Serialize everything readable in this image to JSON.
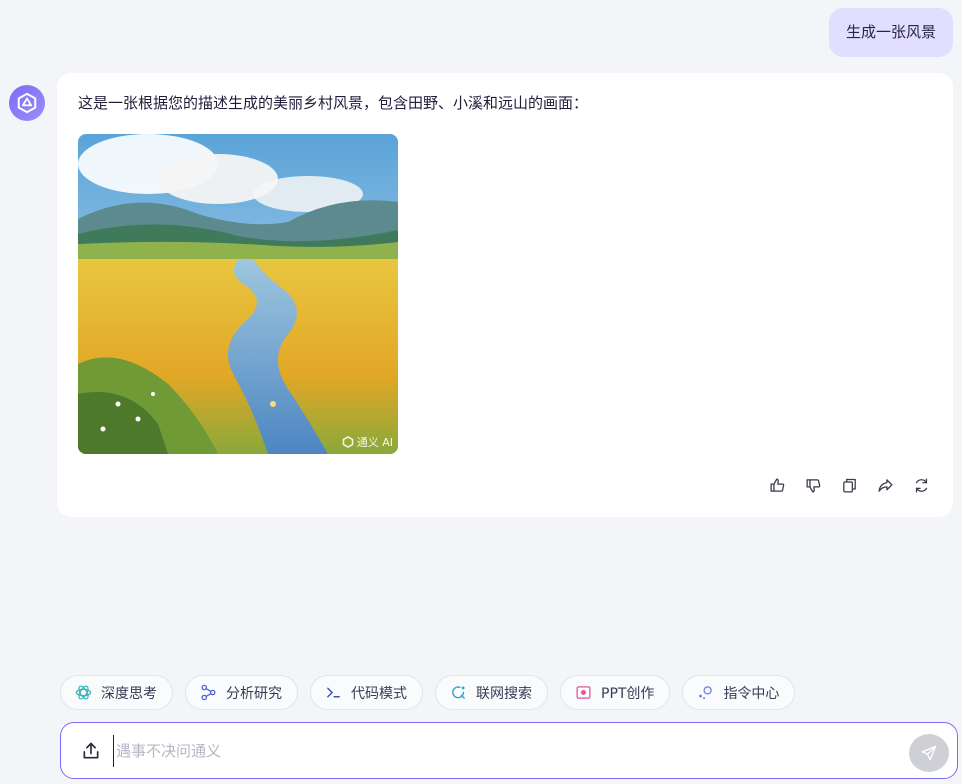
{
  "user_message": {
    "text": "生成一张风景"
  },
  "assistant": {
    "avatar_icon": "tongyi-logo-icon",
    "text": "这是一张根据您的描述生成的美丽乡村风景，包含田野、小溪和远山的画面：",
    "image": {
      "watermark": "通义 AI"
    },
    "actions": [
      {
        "name": "like-button",
        "icon": "thumbs-up-icon"
      },
      {
        "name": "dislike-button",
        "icon": "thumbs-down-icon"
      },
      {
        "name": "copy-button",
        "icon": "copy-icon"
      },
      {
        "name": "share-button",
        "icon": "share-icon"
      },
      {
        "name": "regenerate-button",
        "icon": "refresh-icon"
      }
    ]
  },
  "quick_actions": [
    {
      "label": "深度思考",
      "icon": "deep-think-icon",
      "color": "#3fb8b8"
    },
    {
      "label": "分析研究",
      "icon": "analysis-icon",
      "color": "#4a5fd0"
    },
    {
      "label": "代码模式",
      "icon": "code-icon",
      "color": "#3a4fb8"
    },
    {
      "label": "联网搜索",
      "icon": "web-search-icon",
      "color": "#2fa8c8"
    },
    {
      "label": "PPT创作",
      "icon": "ppt-icon",
      "color": "#e0579a"
    },
    {
      "label": "指令中心",
      "icon": "command-center-icon",
      "color": "#6f7fe0"
    }
  ],
  "input": {
    "placeholder": "遇事不决问通义"
  },
  "colors": {
    "accent": "#7b6cf6",
    "user_bubble": "#e2defe",
    "background": "#f4f5f9"
  }
}
